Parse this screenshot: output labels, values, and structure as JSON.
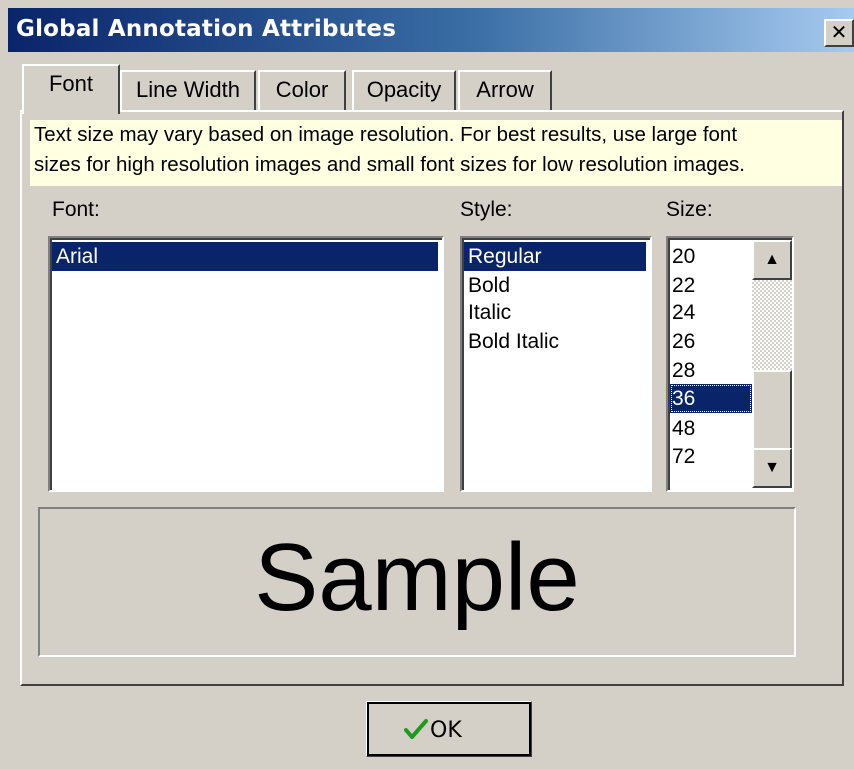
{
  "window": {
    "title": "Global Annotation Attributes",
    "close_glyph": "✕"
  },
  "tabs": [
    {
      "label": "Font",
      "active": true
    },
    {
      "label": "Line Width",
      "active": false
    },
    {
      "label": "Color",
      "active": false
    },
    {
      "label": "Opacity",
      "active": false
    },
    {
      "label": "Arrow",
      "active": false
    }
  ],
  "note": {
    "line1": "Text size may vary based on image resolution. For best results, use large font",
    "line2": "sizes for high resolution images and small font sizes for low resolution images."
  },
  "font": {
    "label": "Font:",
    "items": [
      "Arial"
    ],
    "selected": "Arial"
  },
  "style": {
    "label": "Style:",
    "items": [
      "Regular",
      "Bold",
      "Italic",
      "Bold Italic"
    ],
    "selected": "Regular"
  },
  "size": {
    "label": "Size:",
    "items": [
      "20",
      "22",
      "24",
      "26",
      "28",
      "36",
      "48",
      "72"
    ],
    "selected": "36"
  },
  "sample": {
    "text": "Sample"
  },
  "ok_button": {
    "label": "OK",
    "icon": "checkmark-icon",
    "icon_color": "#1e9b1e"
  },
  "colors": {
    "title_start": "#0a246a",
    "title_end": "#a6caf0",
    "selection": "#0a246a",
    "note_bg": "#ffffe1",
    "face": "#d4d0c8"
  }
}
